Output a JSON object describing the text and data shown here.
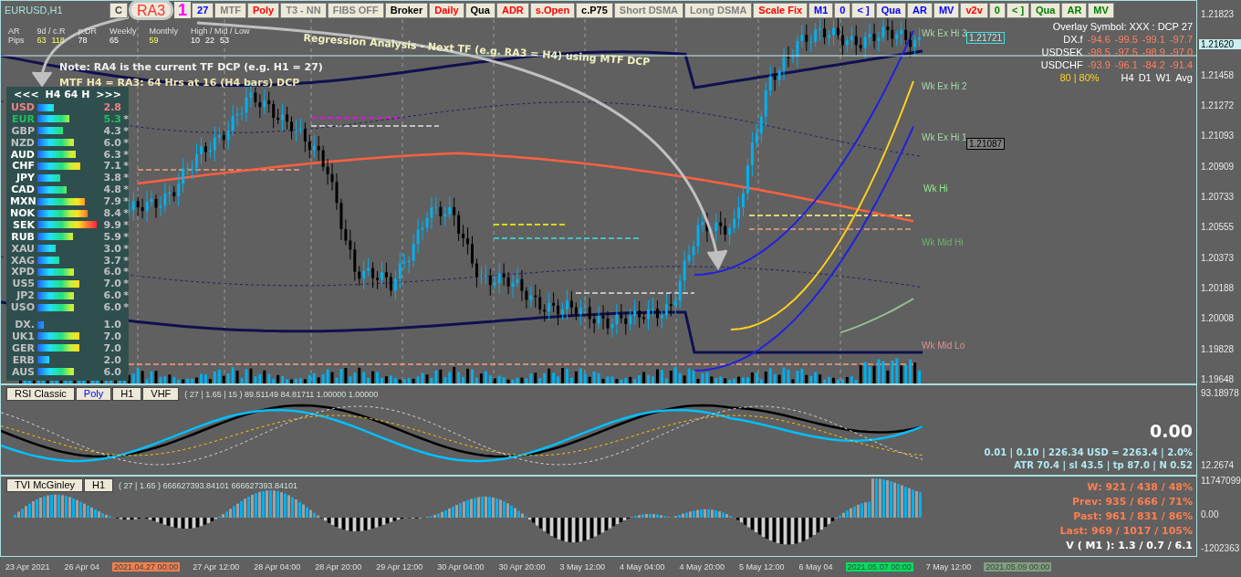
{
  "symbol": "EURUSD,H1",
  "toolbar": [
    {
      "label": "C",
      "color": "#404040",
      "kind": "button"
    },
    {
      "label": "RA3",
      "color": "#ff3030",
      "kind": "badge"
    },
    {
      "label": "1",
      "color": "#ff00ff",
      "kind": "plain"
    },
    {
      "label": "27",
      "color": "#0000ff",
      "kind": "button"
    },
    {
      "label": "MTF",
      "color": "#808080",
      "kind": "button"
    },
    {
      "label": "Poly",
      "color": "#ff0000",
      "kind": "button"
    },
    {
      "label": "T3 - NN",
      "color": "#808080",
      "kind": "button"
    },
    {
      "label": "FIBS OFF",
      "color": "#808080",
      "kind": "button"
    },
    {
      "label": "Broker",
      "color": "#000000",
      "kind": "button"
    },
    {
      "label": "Daily",
      "color": "#ff0000",
      "kind": "button"
    },
    {
      "label": "Qua",
      "color": "#000000",
      "kind": "button"
    },
    {
      "label": "ADR",
      "color": "#ff0000",
      "kind": "button"
    },
    {
      "label": "s.Open",
      "color": "#ff0000",
      "kind": "button"
    },
    {
      "label": "c.P75",
      "color": "#000000",
      "kind": "button"
    },
    {
      "label": "Short DSMA",
      "color": "#808080",
      "kind": "button"
    },
    {
      "label": "Long DSMA",
      "color": "#808080",
      "kind": "button"
    },
    {
      "label": "Scale Fix",
      "color": "#ff0000",
      "kind": "button"
    },
    {
      "label": "M1",
      "color": "#0000ff",
      "kind": "button"
    },
    {
      "label": "0",
      "color": "#0000ff",
      "kind": "button"
    },
    {
      "label": "< ]",
      "color": "#0000ff",
      "kind": "button"
    },
    {
      "label": "Qua",
      "color": "#0000ff",
      "kind": "button"
    },
    {
      "label": "AR",
      "color": "#0000ff",
      "kind": "button"
    },
    {
      "label": "MV",
      "color": "#0000ff",
      "kind": "button"
    },
    {
      "label": "v2v",
      "color": "#ff0000",
      "kind": "button"
    },
    {
      "label": "0",
      "color": "#008000",
      "kind": "button"
    },
    {
      "label": "< ]",
      "color": "#008000",
      "kind": "button"
    },
    {
      "label": "Qua",
      "color": "#008000",
      "kind": "button"
    },
    {
      "label": "AR",
      "color": "#008000",
      "kind": "button"
    },
    {
      "label": "MV",
      "color": "#008000",
      "kind": "button"
    }
  ],
  "range_stats": {
    "row_labels": [
      "AR",
      "Pips"
    ],
    "columns": [
      {
        "heading": "9d / c.R",
        "values": [
          "63",
          "118"
        ]
      },
      {
        "heading": "p.DR",
        "values": [
          "78"
        ]
      },
      {
        "heading": "Weekly",
        "values": [
          "65"
        ]
      },
      {
        "heading": "Monthly",
        "values": [
          "59"
        ]
      },
      {
        "heading": "High / Mid / Low",
        "values": [
          "10",
          "22",
          "53"
        ]
      }
    ]
  },
  "annotations": {
    "title": "Regression Analysis - Next TF (e.g. RA3 = H4) using MTF DCP",
    "note": "Note:  RA4 is the current TF DCP (e.g. H1 = 27)",
    "mtf": "MTF H4  = RA3: 64 Hrs at 16 (H4 bars)  DCP"
  },
  "strength_panel": {
    "prev": "<<<",
    "title": "H4  64  H",
    "next": ">>>",
    "rows": [
      {
        "name": "USD",
        "value": "2.8",
        "color": "#f08080"
      },
      {
        "name": "EUR",
        "value": "5.3",
        "flag": "*",
        "color": "#20c060"
      },
      {
        "name": "GBP",
        "value": "4.3",
        "flag": "*",
        "color": "#c0c0c0"
      },
      {
        "name": "NZD",
        "value": "6.0",
        "flag": "*",
        "color": "#c0c0c0"
      },
      {
        "name": "AUD",
        "value": "6.3",
        "flag": "*",
        "color": "#ffffff"
      },
      {
        "name": "CHF",
        "value": "7.1",
        "flag": "*",
        "color": "#ffffff"
      },
      {
        "name": "JPY",
        "value": "3.8",
        "flag": "*",
        "color": "#ffffff"
      },
      {
        "name": "CAD",
        "value": "4.8",
        "flag": "*",
        "color": "#ffffff"
      },
      {
        "name": "MXN",
        "value": "7.9",
        "flag": "*",
        "color": "#ffffff"
      },
      {
        "name": "NOK",
        "value": "8.4",
        "flag": "*",
        "color": "#ffffff"
      },
      {
        "name": "SEK",
        "value": "9.9",
        "flag": "*",
        "color": "#ffffff"
      },
      {
        "name": "RUB",
        "value": "5.9",
        "flag": "*",
        "color": "#ffffff"
      },
      {
        "name": "XAU",
        "value": "3.0",
        "flag": "*",
        "color": "#c0c0c0"
      },
      {
        "name": "XAG",
        "value": "3.7",
        "flag": "*",
        "color": "#c0c0c0"
      },
      {
        "name": "XPD",
        "value": "6.0",
        "flag": "*",
        "color": "#c0c0c0"
      },
      {
        "name": "US5",
        "value": "7.0",
        "flag": "*",
        "color": "#c0c0c0"
      },
      {
        "name": "JP2",
        "value": "6.0",
        "flag": "*",
        "color": "#c0c0c0"
      },
      {
        "name": "USO",
        "value": "6.0",
        "flag": "*",
        "color": "#c0c0c0"
      }
    ],
    "index_rows": [
      {
        "name": "DX.",
        "value": "1.0"
      },
      {
        "name": "UK1",
        "value": "7.0"
      },
      {
        "name": "GER",
        "value": "7.0"
      },
      {
        "name": "ERB",
        "value": "2.0"
      },
      {
        "name": "AUS",
        "value": "6.0"
      }
    ]
  },
  "overlay": {
    "title": "Overlay Symbol: XXX : DCP 27",
    "rows": [
      {
        "symbol": "DX.f",
        "values": [
          "-94.6",
          "-99.5",
          "-99.1",
          "-97.7"
        ]
      },
      {
        "symbol": "USDSEK",
        "values": [
          "-98.5",
          "-97.5",
          "-98.9",
          "-97.0"
        ]
      },
      {
        "symbol": "USDCHF",
        "values": [
          "-93.9",
          "-96.1",
          "-84.2",
          "-91.4"
        ]
      }
    ],
    "score": "80 | 80%",
    "timeframes": [
      "H4",
      "D1",
      "W1",
      "Avg"
    ]
  },
  "chart_labels": [
    {
      "text": "Wk Ex Hi 3",
      "color": "#a8d8a8"
    },
    {
      "text": "Wk Ex Hi 2",
      "color": "#a8d8a8"
    },
    {
      "text": "Wk Ex Hi 1",
      "color": "#a8d8a8"
    },
    {
      "text": "Wk Hi",
      "color": "#90ee90"
    },
    {
      "text": "Wk Mid Hi",
      "color": "#70b070"
    },
    {
      "text": "Wk Mid Lo",
      "color": "#e09090"
    }
  ],
  "price_tags": [
    {
      "text": "1.21721",
      "kind": "outlined"
    },
    {
      "text": "1.21087",
      "kind": "dark"
    }
  ],
  "price_axis": [
    {
      "label": "1.21823",
      "kind": "tick"
    },
    {
      "label": "1.21620",
      "kind": "current"
    },
    {
      "label": "1.21458",
      "kind": "tick"
    },
    {
      "label": "1.21272",
      "kind": "tick"
    },
    {
      "label": "1.21093",
      "kind": "tick"
    },
    {
      "label": "1.20909",
      "kind": "tick"
    },
    {
      "label": "1.20733",
      "kind": "tick"
    },
    {
      "label": "1.20555",
      "kind": "tick"
    },
    {
      "label": "1.20373",
      "kind": "tick"
    },
    {
      "label": "1.20188",
      "kind": "tick"
    },
    {
      "label": "1.20008",
      "kind": "tick"
    },
    {
      "label": "1.19828",
      "kind": "tick"
    },
    {
      "label": "1.19648",
      "kind": "tick"
    }
  ],
  "rsi_pane": {
    "buttons": [
      {
        "label": "RSI Classic",
        "color": "#000000"
      },
      {
        "label": "Poly",
        "color": "#0000ff"
      },
      {
        "label": "H1",
        "color": "#000000"
      },
      {
        "label": "VHF",
        "color": "#000000"
      }
    ],
    "readout": "( 27 | 1.65 | 15 ) 89.51149 84.81711 1.00000 1.00000",
    "result": "0.00",
    "lot_line": "0.01  |  0.10  |  226.34 USD = 2263.4  |  2.0%",
    "atr_line": "ATR 70.4  | sl 43.5  |  tp 87.0  |  N 0.52",
    "axis": [
      "93.18978",
      "12.2674"
    ]
  },
  "tvi_pane": {
    "buttons": [
      {
        "label": "TVI McGinley",
        "color": "#000000"
      },
      {
        "label": "H1",
        "color": "#000000"
      }
    ],
    "readout": "( 27 | 1.65 ) 666627393.84101 666627393.84101",
    "stats": [
      {
        "text": "W: 921 / 438 / 48%",
        "color": "#ff7f50"
      },
      {
        "text": "Prev: 935 / 666 / 71%",
        "color": "#ff7f50"
      },
      {
        "text": "Past: 961 / 831 / 86%",
        "color": "#ff7f50"
      },
      {
        "text": "Last: 969 / 1017 / 105%",
        "color": "#ff7f50"
      },
      {
        "text": "V ( M1 ): 1.3 / 0.7 / 6.1",
        "color": "#ffffff"
      }
    ],
    "axis": [
      "11747099",
      "0.00",
      "-1202363"
    ]
  },
  "time_axis": [
    {
      "label": "23 Apr 2021",
      "kind": "tick"
    },
    {
      "label": "26 Apr 04",
      "kind": "tick"
    },
    {
      "label": "2021.04.27 00:00",
      "kind": "marker",
      "color": "#f08050"
    },
    {
      "label": "27 Apr 12:00",
      "kind": "tick"
    },
    {
      "label": "28 Apr 04:00",
      "kind": "tick"
    },
    {
      "label": "28 Apr 20:00",
      "kind": "tick"
    },
    {
      "label": "29 Apr 12:00",
      "kind": "tick"
    },
    {
      "label": "30 Apr 04:00",
      "kind": "tick"
    },
    {
      "label": "30 Apr 20:00",
      "kind": "tick"
    },
    {
      "label": "3 May 12:00",
      "kind": "tick"
    },
    {
      "label": "4 May 04:00",
      "kind": "tick"
    },
    {
      "label": "4 May 20:00",
      "kind": "tick"
    },
    {
      "label": "5 May 12:00",
      "kind": "tick"
    },
    {
      "label": "6 May 04",
      "kind": "tick"
    },
    {
      "label": "2021.05.07 00:00",
      "kind": "marker",
      "color": "#00e060"
    },
    {
      "label": "7 May 12:00",
      "kind": "tick"
    },
    {
      "label": "2021.05.09 00:00",
      "kind": "marker",
      "color": "#80a080"
    }
  ]
}
